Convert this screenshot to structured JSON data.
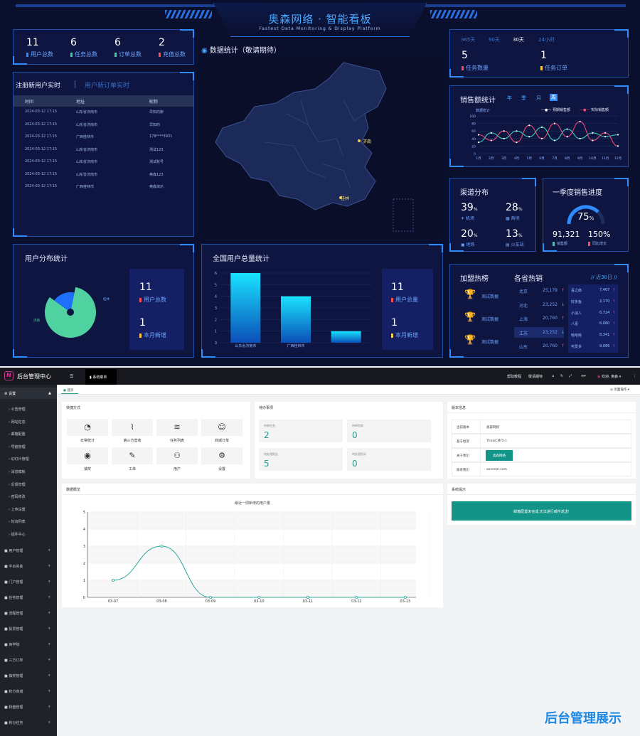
{
  "dashboard": {
    "title": "奥森网络 · 智能看板",
    "subtitle": "Fastest Data Monitoring & Display Platform",
    "stats_top": [
      {
        "value": "11",
        "label": "用户总数",
        "color": "#2f8cff"
      },
      {
        "value": "6",
        "label": "任务总数",
        "color": "#35d29a"
      },
      {
        "value": "6",
        "label": "订单总数",
        "color": "#35d29a"
      },
      {
        "value": "2",
        "label": "充值总数",
        "color": "#ff4d4f"
      }
    ],
    "map_title": "数据统计（敬请期待）",
    "map_cities": [
      "济南",
      "桂林"
    ],
    "reg_tabs": [
      "注册新用户实时",
      "用户新订单实时"
    ],
    "reg_headers": [
      "时间",
      "地址",
      "昵称"
    ],
    "reg_rows": [
      [
        "2024-03-12 17:15",
        "山东省济南市",
        "早知的擀"
      ],
      [
        "2024-03-12 17:15",
        "山东省济南市",
        "早知的"
      ],
      [
        "2024-03-12 17:15",
        "广西桂林市",
        "178****3931"
      ],
      [
        "2024-03-12 17:15",
        "山东省济南市",
        "测试123"
      ],
      [
        "2024-03-12 17:15",
        "山东省济南市",
        "测试账号"
      ],
      [
        "2024-03-12 17:15",
        "山东省济南市",
        "奥森123"
      ],
      [
        "2024-03-12 17:15",
        "广西桂林市",
        "奥森演示"
      ]
    ],
    "range_tabs": [
      "365天",
      "90天",
      "30天",
      "24小时"
    ],
    "range_stats": [
      {
        "value": "5",
        "label": "任务数量",
        "color": "#ff4d4f"
      },
      {
        "value": "1",
        "label": "任务订单",
        "color": "#f7c948"
      }
    ],
    "sales": {
      "title": "销售额统计",
      "tabs": [
        "年",
        "季",
        "月",
        "周"
      ],
      "ylabel": "数据统计",
      "legend": [
        "预期销售额",
        "实际销售额"
      ],
      "months": [
        "1月",
        "2月",
        "3月",
        "4月",
        "5月",
        "6月",
        "7月",
        "8月",
        "9月",
        "10月",
        "11月",
        "12月"
      ],
      "y_ticks": [
        0,
        20,
        40,
        60,
        80,
        100
      ]
    },
    "channel": {
      "title": "渠道分布",
      "items": [
        {
          "value": "39",
          "unit": "%",
          "label": "机场"
        },
        {
          "value": "28",
          "unit": "%",
          "label": "商场"
        },
        {
          "value": "20",
          "unit": "%",
          "label": "地铁"
        },
        {
          "value": "13",
          "unit": "%",
          "label": "火车站"
        }
      ]
    },
    "progress": {
      "title": "一季度销售进度",
      "percent": "75",
      "percent_unit": "%",
      "sales": "91,321",
      "sales_label": "销售额",
      "growth": "150%",
      "growth_label": "同比增长"
    },
    "hot": {
      "title1": "加盟热榜",
      "title2": "各省热销",
      "range": "// 近30日 //",
      "franchise": [
        "测试数据",
        "测试数据",
        "测试数据"
      ],
      "provinces": [
        {
          "name": "北京",
          "value": "25,179",
          "trend": "up"
        },
        {
          "name": "河北",
          "value": "23,252",
          "trend": "down"
        },
        {
          "name": "上海",
          "value": "20,760",
          "trend": "up"
        },
        {
          "name": "江苏",
          "value": "23,252",
          "trend": "down"
        },
        {
          "name": "山东",
          "value": "20,760",
          "trend": "up"
        }
      ],
      "shops": [
        {
          "name": "喜之郎",
          "value": "7,407"
        },
        {
          "name": "好多鱼",
          "value": "2,170"
        },
        {
          "name": "小浣人",
          "value": "6,724"
        },
        {
          "name": "八喜",
          "value": "6,080"
        },
        {
          "name": "哈哈哈",
          "value": "8,341"
        },
        {
          "name": "可爱多",
          "value": "9,086"
        }
      ]
    },
    "user_dist": {
      "title": "用户分布统计",
      "pie_labels": [
        "济南",
        "桂林"
      ],
      "total_value": "11",
      "total_label": "用户总数",
      "new_value": "1",
      "new_label": "本月新增"
    },
    "total_users": {
      "title": "全国用户总量统计",
      "total_value": "11",
      "total_label": "用户总量",
      "new_value": "1",
      "new_label": "本月新增"
    }
  },
  "admin": {
    "brand": "后台管理中心",
    "top_tab": "系统菜单",
    "header_right": [
      "帮助教程",
      "敬请期待",
      "欢迎, 奥森"
    ],
    "page_tab": "首页",
    "page_ops": "页面操作",
    "sidebar": {
      "settings": "设置",
      "sub_items": [
        "公告管理",
        "网站信息",
        "邮箱配置",
        "导航管理",
        "幻灯片管理",
        "消息模板",
        "反馈管理",
        "密码修改",
        "上传设置",
        "轮询列表",
        "插件中心"
      ],
      "groups": [
        "用户管理",
        "平台资金",
        "门户管理",
        "任务管理",
        "流程管理",
        "投票管理",
        "商学院",
        "三方订单",
        "抽奖管理",
        "积分商城",
        "转盘管理",
        "积分任务"
      ]
    },
    "quick": {
      "title": "快捷方式",
      "items": [
        "日常统计",
        "第三方营收",
        "任务列表",
        "商城订单",
        "抽奖",
        "工单",
        "用户",
        "设置"
      ]
    },
    "todo": {
      "title": "待办事项",
      "items": [
        {
          "label": "待审任务",
          "value": "2"
        },
        {
          "label": "待审验收",
          "value": "0"
        },
        {
          "label": "待处理报告",
          "value": "5"
        },
        {
          "label": "待处理投诉",
          "value": "0"
        }
      ]
    },
    "version": {
      "title": "版本信息",
      "rows": [
        {
          "key": "当前版本",
          "value": "奥森网络"
        },
        {
          "key": "基于框架",
          "value": "ThinkCMF5.1"
        },
        {
          "key": "关于我们",
          "value": "奥森网络"
        },
        {
          "key": "联系我们",
          "value": "aosenm.com"
        }
      ]
    },
    "overview": {
      "title": "数据概览",
      "chart_title": "最近一周新增的用户量"
    },
    "notice": {
      "title": "系统提示",
      "message": "邮箱配置未完成,无法进行邮件发送!"
    },
    "footer_brand": "后台管理展示"
  },
  "chart_data": [
    {
      "type": "line",
      "title": "最近一周新增的用户量",
      "x": [
        "03-07",
        "03-08",
        "03-09",
        "03-10",
        "03-11",
        "03-12",
        "03-13"
      ],
      "values": [
        1,
        3,
        0,
        0,
        0,
        0,
        0
      ],
      "ylim": [
        0,
        5
      ],
      "y_ticks": [
        0,
        1,
        2,
        3,
        4,
        5
      ],
      "color": "#2ca89a"
    },
    {
      "type": "bar",
      "title": "全国用户总量统计",
      "categories": [
        "山东省济南市",
        "广西桂林市",
        ""
      ],
      "values": [
        6,
        4,
        1
      ],
      "ylim": [
        0,
        6
      ],
      "y_ticks": [
        0,
        1,
        2,
        3,
        4,
        5,
        6
      ]
    },
    {
      "type": "line",
      "title": "销售额统计",
      "x": [
        "1月",
        "2月",
        "3月",
        "4月",
        "5月",
        "6月",
        "7月",
        "8月",
        "9月",
        "10月",
        "11月",
        "12月"
      ],
      "series": [
        {
          "name": "预期销售额",
          "values": [
            30,
            55,
            40,
            60,
            45,
            70,
            35,
            65,
            40,
            55,
            45,
            50
          ]
        },
        {
          "name": "实际销售额",
          "values": [
            50,
            35,
            60,
            30,
            75,
            40,
            80,
            45,
            85,
            35,
            55,
            20
          ]
        }
      ],
      "ylim": [
        0,
        100
      ]
    },
    {
      "type": "pie",
      "title": "用户分布统计",
      "categories": [
        "济南",
        "桂林"
      ],
      "values": [
        9,
        2
      ]
    }
  ]
}
